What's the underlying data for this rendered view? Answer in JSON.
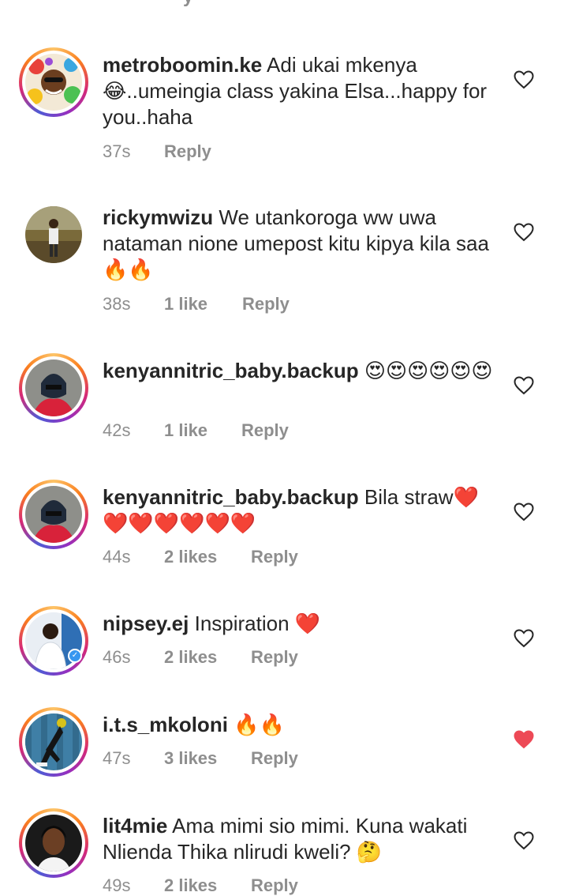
{
  "partial_top": {
    "text": "y"
  },
  "comments": [
    {
      "username": "metroboomin.ke",
      "text": "Adi ukai mkenya 😂..umeingia class yakina  Elsa...happy for you..haha",
      "time": "37s",
      "likes": "",
      "reply": "Reply",
      "liked": false,
      "story_ring": true,
      "verified": false,
      "avatar": "colorful-illustration-avatar"
    },
    {
      "username": "rickymwizu",
      "text": "We utankoroga ww uwa nataman nione umepost kitu kipya kila saa🔥🔥",
      "time": "38s",
      "likes": "1 like",
      "reply": "Reply",
      "liked": false,
      "story_ring": false,
      "verified": false,
      "avatar": "outdoor-person-avatar"
    },
    {
      "username": "kenyannitric_baby.backup",
      "text": "😍😍😍😍😍😍",
      "time": "42s",
      "likes": "1 like",
      "reply": "Reply",
      "liked": false,
      "story_ring": true,
      "verified": false,
      "avatar": "masked-person-avatar"
    },
    {
      "username": "kenyannitric_baby.backup",
      "text": "Bila straw❤️❤️❤️❤️❤️❤️❤️",
      "time": "44s",
      "likes": "2 likes",
      "reply": "Reply",
      "liked": false,
      "story_ring": true,
      "verified": false,
      "avatar": "masked-person-avatar"
    },
    {
      "username": "nipsey.ej",
      "text": "Inspiration ❤️",
      "time": "46s",
      "likes": "2 likes",
      "reply": "Reply",
      "liked": false,
      "story_ring": true,
      "verified": true,
      "avatar": "person-white-shirt-avatar"
    },
    {
      "username": "i.t.s_mkoloni",
      "text": "🔥🔥",
      "time": "47s",
      "likes": "3 likes",
      "reply": "Reply",
      "liked": true,
      "story_ring": true,
      "verified": false,
      "avatar": "blue-wall-person-avatar"
    },
    {
      "username": "lit4mie",
      "text": "Ama mimi sio mimi. Kuna wakati Nlienda Thika nlirudi kweli? 🤔",
      "time": "49s",
      "likes": "2 likes",
      "reply": "Reply",
      "liked": false,
      "story_ring": true,
      "verified": false,
      "avatar": "woman-portrait-avatar"
    }
  ],
  "colors": {
    "text": "#262626",
    "secondary": "#8e8e8e",
    "liked_heart": "#ed4956",
    "verified": "#3897f0"
  }
}
